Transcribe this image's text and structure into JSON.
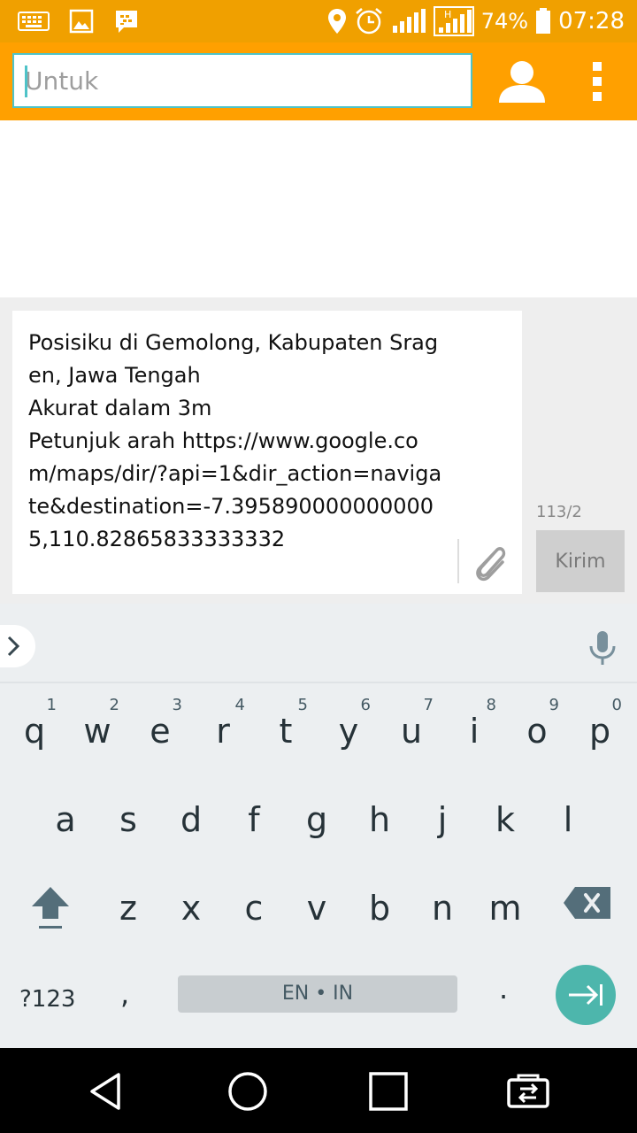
{
  "status_bar": {
    "icons_left": [
      "keyboard-icon",
      "image-icon",
      "bbm-icon"
    ],
    "icons_right": [
      "location-icon",
      "alarm-icon",
      "signal-icon",
      "h-signal-icon",
      "battery-icon"
    ],
    "battery": "74%",
    "time": "07:28"
  },
  "header": {
    "to_placeholder": "Untuk",
    "accent_color": "#ffa000"
  },
  "compose": {
    "message": "Posisiku di Gemolong, Kabupaten Sragen, Jawa Tengah\nAkurat dalam 3m\nPetunjuk arah https://www.google.com/maps/dir/?api=1&dir_action=navigate&destination=-7.3958900000000005,110.82865833333332",
    "counter": "113/2",
    "send_label": "Kirim"
  },
  "keyboard": {
    "row1": [
      {
        "ch": "q",
        "num": "1"
      },
      {
        "ch": "w",
        "num": "2"
      },
      {
        "ch": "e",
        "num": "3"
      },
      {
        "ch": "r",
        "num": "4"
      },
      {
        "ch": "t",
        "num": "5"
      },
      {
        "ch": "y",
        "num": "6"
      },
      {
        "ch": "u",
        "num": "7"
      },
      {
        "ch": "i",
        "num": "8"
      },
      {
        "ch": "o",
        "num": "9"
      },
      {
        "ch": "p",
        "num": "0"
      }
    ],
    "row2": [
      "a",
      "s",
      "d",
      "f",
      "g",
      "h",
      "j",
      "k",
      "l"
    ],
    "row3": [
      "z",
      "x",
      "c",
      "v",
      "b",
      "n",
      "m"
    ],
    "symbols_label": "?123",
    "comma": ",",
    "space_label": "EN • IN",
    "period": ".",
    "enter_color": "#4db6ac"
  },
  "navbar": {
    "buttons": [
      "back-icon",
      "home-icon",
      "recents-icon",
      "switch-apps-icon"
    ]
  }
}
